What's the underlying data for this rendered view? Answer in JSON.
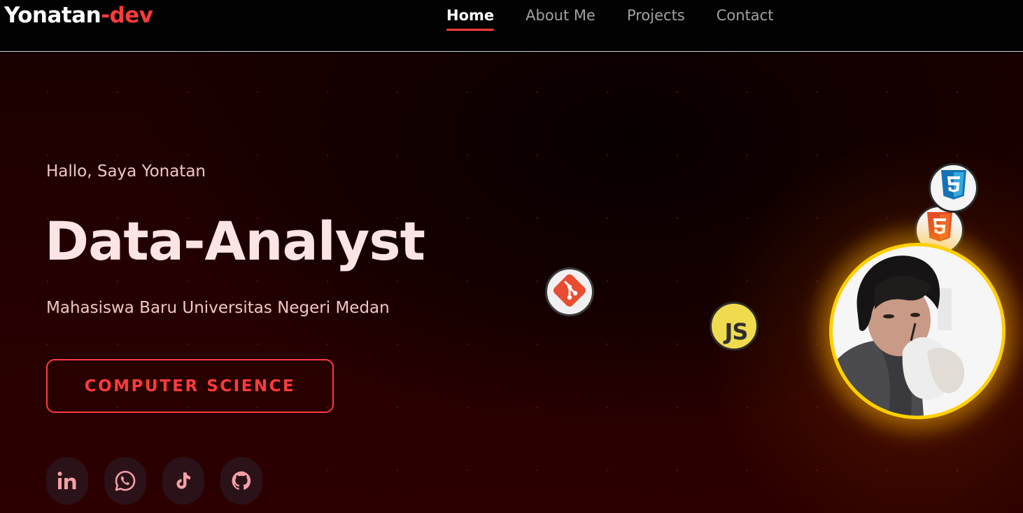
{
  "navbar": {
    "logo_part1": "Yonatan",
    "logo_part2": "-dev",
    "links": [
      {
        "label": "Home",
        "active": true
      },
      {
        "label": "About Me",
        "active": false
      },
      {
        "label": "Projects",
        "active": false
      },
      {
        "label": "Contact",
        "active": false
      }
    ]
  },
  "hero": {
    "greeting": "Hallo, Saya Yonatan",
    "title": "Data-Analyst",
    "subtitle": "Mahasiswa Baru Universitas Negeri Medan",
    "cta_label": "COMPUTER SCIENCE",
    "socials": [
      {
        "icon": "linkedin-icon"
      },
      {
        "icon": "whatsapp-icon"
      },
      {
        "icon": "tiktok-icon"
      },
      {
        "icon": "github-icon"
      }
    ],
    "tech_badges": [
      {
        "icon": "git-icon"
      },
      {
        "icon": "javascript-icon",
        "text": "JS"
      },
      {
        "icon": "html5-icon"
      },
      {
        "icon": "css3-icon"
      }
    ],
    "avatar": {
      "icon": "profile-photo"
    }
  },
  "colors": {
    "accent": "#ff3b3b",
    "avatar_ring": "#ffd000",
    "background": "#240000"
  }
}
